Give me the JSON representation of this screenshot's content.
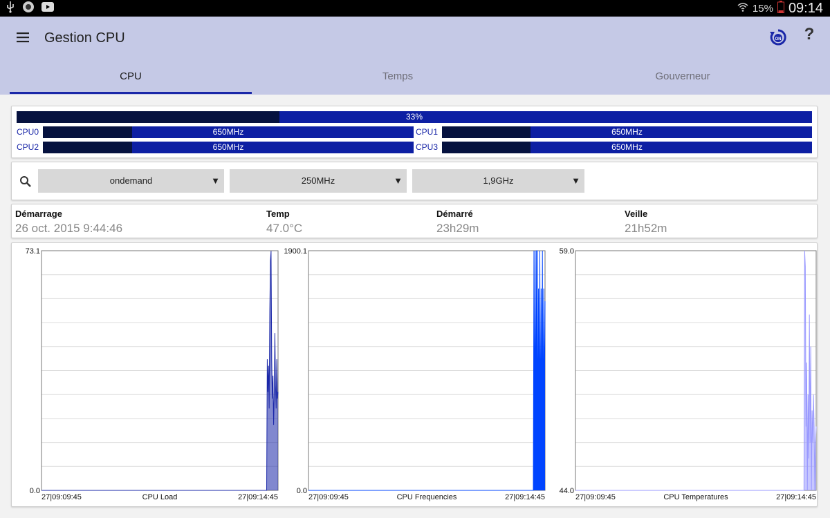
{
  "status_bar": {
    "left_icons": [
      "usb-icon",
      "camera-icon",
      "youtube-icon"
    ],
    "battery_percent": "15%",
    "time": "09:14"
  },
  "app": {
    "title": "Gestion CPU",
    "tabs": [
      {
        "label": "CPU",
        "active": true
      },
      {
        "label": "Temps",
        "active": false
      },
      {
        "label": "Gouverneur",
        "active": false
      }
    ]
  },
  "cpu_usage": {
    "total_label": "33%",
    "total_fraction": 0.33,
    "cores": [
      {
        "name": "CPU0",
        "freq": "650MHz",
        "fraction": 0.24
      },
      {
        "name": "CPU1",
        "freq": "650MHz",
        "fraction": 0.24
      },
      {
        "name": "CPU2",
        "freq": "650MHz",
        "fraction": 0.24
      },
      {
        "name": "CPU3",
        "freq": "650MHz",
        "fraction": 0.24
      }
    ]
  },
  "governor": {
    "governor": "ondemand",
    "min_freq": "250MHz",
    "max_freq": "1,9GHz"
  },
  "info": {
    "boot_label": "Démarrage",
    "boot_value": "26 oct. 2015 9:44:46",
    "temp_label": "Temp",
    "temp_value": "47.0°C",
    "uptime_label": "Démarré",
    "uptime_value": "23h29m",
    "sleep_label": "Veille",
    "sleep_value": "21h52m"
  },
  "colors": {
    "appbar": "#c5c9e6",
    "accent": "#1a27a8",
    "bar": "#0d1fa3",
    "bar_fill": "#06123f",
    "chart_load": "#1a27a8",
    "chart_freq": "#0044ff",
    "chart_temp": "#9999ff"
  },
  "chart_data": [
    {
      "type": "area",
      "title": "CPU Load",
      "x_start": "27|09:09:45",
      "x_end": "27|09:14:45",
      "ylim": [
        0.0,
        73.1
      ],
      "y_max_label": "73.1",
      "y_min_label": "0.0",
      "grid": true,
      "values": [
        0,
        0,
        0,
        0,
        0,
        0,
        0,
        0,
        0,
        0,
        0,
        0,
        0,
        0,
        0,
        0,
        0,
        0,
        0,
        0,
        0,
        0,
        0,
        0,
        0,
        0,
        0,
        0,
        0,
        0,
        0,
        0,
        0,
        0,
        0,
        0,
        0,
        0,
        0,
        0,
        0,
        0,
        0,
        0,
        0,
        0,
        0,
        0,
        0,
        0,
        0,
        0,
        0,
        0,
        0,
        0,
        0,
        0,
        0,
        0,
        0,
        0,
        0,
        0,
        0,
        0,
        0,
        0,
        0,
        0,
        0,
        0,
        0,
        0,
        0,
        0,
        0,
        0,
        0,
        0,
        0,
        0,
        0,
        0,
        0,
        0,
        0,
        0,
        0,
        0,
        0,
        0,
        0,
        0,
        0,
        0,
        0,
        0,
        0,
        0,
        0,
        0,
        0,
        0,
        0,
        0,
        0,
        0,
        0,
        0,
        0,
        0,
        0,
        0,
        0,
        0,
        0,
        0,
        0,
        0,
        0,
        0,
        0,
        0,
        0,
        0,
        0,
        0,
        0,
        0,
        0,
        0,
        0,
        0,
        0,
        0,
        0,
        0,
        0,
        0,
        0,
        0,
        0,
        0,
        0,
        0,
        0,
        0,
        0,
        0,
        0,
        0,
        0,
        0,
        0,
        0,
        0,
        0,
        0,
        0,
        0,
        0,
        0,
        0,
        0,
        0,
        0,
        0,
        0,
        0,
        0,
        0,
        0,
        0,
        0,
        0,
        0,
        0,
        0,
        0,
        0,
        0,
        0,
        0,
        0,
        0,
        0,
        0,
        0,
        0,
        0,
        0,
        0,
        0,
        0,
        0,
        0,
        0,
        0,
        0,
        0,
        0,
        0,
        0,
        0,
        0,
        0,
        0,
        0,
        0,
        0,
        0,
        0,
        0,
        0,
        0,
        0,
        0,
        0,
        0,
        0,
        0,
        0,
        0,
        0,
        0,
        0,
        0,
        0,
        0,
        0,
        0,
        0,
        0,
        0,
        0,
        0,
        0,
        0,
        0,
        0,
        0,
        0,
        0,
        0,
        0,
        0,
        0,
        0,
        0,
        0,
        0,
        0,
        0,
        0,
        0,
        0,
        0,
        0,
        0,
        0,
        0,
        0,
        0,
        0,
        0,
        0,
        0,
        0,
        0,
        0,
        0,
        0,
        0,
        0,
        0,
        0,
        0,
        0,
        0,
        0,
        0,
        0,
        0,
        0,
        0,
        0,
        0,
        0,
        0,
        0,
        0,
        0,
        0,
        0,
        0,
        0,
        0,
        0,
        0,
        0,
        0,
        0,
        0,
        0,
        0,
        0,
        0,
        0,
        0,
        0,
        0,
        0,
        0,
        0,
        0,
        0,
        0,
        0,
        0,
        0,
        0,
        0,
        0,
        0,
        0,
        0,
        0,
        0,
        0,
        0,
        0,
        0,
        0,
        0,
        0,
        0,
        0,
        0,
        0,
        0,
        0,
        0,
        0,
        0,
        0,
        0,
        0,
        0,
        0,
        0,
        0,
        0,
        0,
        0,
        0,
        40,
        30,
        38,
        25,
        55,
        70,
        73,
        40,
        28,
        35,
        20,
        30,
        48,
        32,
        25,
        40,
        28,
        30
      ]
    },
    {
      "type": "area",
      "title": "CPU Frequencies",
      "x_start": "27|09:09:45",
      "x_end": "27|09:14:45",
      "ylim": [
        0.0,
        1900.1
      ],
      "y_max_label": "1900.1",
      "y_min_label": "0.0",
      "grid": true,
      "values": [
        0,
        0,
        0,
        0,
        0,
        0,
        0,
        0,
        0,
        0,
        0,
        0,
        0,
        0,
        0,
        0,
        0,
        0,
        0,
        0,
        0,
        0,
        0,
        0,
        0,
        0,
        0,
        0,
        0,
        0,
        0,
        0,
        0,
        0,
        0,
        0,
        0,
        0,
        0,
        0,
        0,
        0,
        0,
        0,
        0,
        0,
        0,
        0,
        0,
        0,
        0,
        0,
        0,
        0,
        0,
        0,
        0,
        0,
        0,
        0,
        0,
        0,
        0,
        0,
        0,
        0,
        0,
        0,
        0,
        0,
        0,
        0,
        0,
        0,
        0,
        0,
        0,
        0,
        0,
        0,
        0,
        0,
        0,
        0,
        0,
        0,
        0,
        0,
        0,
        0,
        0,
        0,
        0,
        0,
        0,
        0,
        0,
        0,
        0,
        0,
        0,
        0,
        0,
        0,
        0,
        0,
        0,
        0,
        0,
        0,
        0,
        0,
        0,
        0,
        0,
        0,
        0,
        0,
        0,
        0,
        0,
        0,
        0,
        0,
        0,
        0,
        0,
        0,
        0,
        0,
        0,
        0,
        0,
        0,
        0,
        0,
        0,
        0,
        0,
        0,
        0,
        0,
        0,
        0,
        0,
        0,
        0,
        0,
        0,
        0,
        0,
        0,
        0,
        0,
        0,
        0,
        0,
        0,
        0,
        0,
        0,
        0,
        0,
        0,
        0,
        0,
        0,
        0,
        0,
        0,
        0,
        0,
        0,
        0,
        0,
        0,
        0,
        0,
        0,
        0,
        0,
        0,
        0,
        0,
        0,
        0,
        0,
        0,
        0,
        0,
        0,
        0,
        0,
        0,
        0,
        0,
        0,
        0,
        0,
        0,
        0,
        0,
        0,
        0,
        0,
        0,
        0,
        0,
        0,
        0,
        0,
        0,
        0,
        0,
        0,
        0,
        0,
        0,
        0,
        0,
        0,
        0,
        0,
        0,
        0,
        0,
        0,
        0,
        0,
        0,
        0,
        0,
        0,
        0,
        0,
        0,
        0,
        0,
        0,
        0,
        0,
        0,
        0,
        0,
        0,
        0,
        0,
        0,
        0,
        0,
        0,
        0,
        0,
        0,
        0,
        0,
        0,
        0,
        0,
        0,
        0,
        0,
        0,
        0,
        0,
        0,
        0,
        0,
        0,
        0,
        0,
        0,
        0,
        0,
        0,
        0,
        0,
        0,
        0,
        0,
        0,
        0,
        0,
        0,
        0,
        0,
        0,
        0,
        0,
        0,
        0,
        0,
        0,
        0,
        0,
        0,
        0,
        0,
        0,
        0,
        0,
        0,
        0,
        0,
        0,
        0,
        0,
        0,
        0,
        0,
        0,
        0,
        0,
        0,
        0,
        0,
        0,
        0,
        0,
        0,
        0,
        0,
        0,
        0,
        0,
        0,
        0,
        0,
        0,
        0,
        0,
        0,
        0,
        0,
        0,
        0,
        0,
        0,
        0,
        0,
        0,
        0,
        0,
        0,
        0,
        0,
        1900,
        250,
        1900,
        250,
        1900,
        1900,
        250,
        1600,
        250,
        1900,
        250,
        1600,
        250,
        1900,
        250,
        1600,
        650,
        1500
      ]
    },
    {
      "type": "area",
      "title": "CPU Temperatures",
      "x_start": "27|09:09:45",
      "x_end": "27|09:14:45",
      "ylim": [
        44.0,
        59.0
      ],
      "y_max_label": "59.0",
      "y_min_label": "44.0",
      "grid": true,
      "values": [
        44,
        44,
        44,
        44,
        44,
        44,
        44,
        44,
        44,
        44,
        44,
        44,
        44,
        44,
        44,
        44,
        44,
        44,
        44,
        44,
        44,
        44,
        44,
        44,
        44,
        44,
        44,
        44,
        44,
        44,
        44,
        44,
        44,
        44,
        44,
        44,
        44,
        44,
        44,
        44,
        44,
        44,
        44,
        44,
        44,
        44,
        44,
        44,
        44,
        44,
        44,
        44,
        44,
        44,
        44,
        44,
        44,
        44,
        44,
        44,
        44,
        44,
        44,
        44,
        44,
        44,
        44,
        44,
        44,
        44,
        44,
        44,
        44,
        44,
        44,
        44,
        44,
        44,
        44,
        44,
        44,
        44,
        44,
        44,
        44,
        44,
        44,
        44,
        44,
        44,
        44,
        44,
        44,
        44,
        44,
        44,
        44,
        44,
        44,
        44,
        44,
        44,
        44,
        44,
        44,
        44,
        44,
        44,
        44,
        44,
        44,
        44,
        44,
        44,
        44,
        44,
        44,
        44,
        44,
        44,
        44,
        44,
        44,
        44,
        44,
        44,
        44,
        44,
        44,
        44,
        44,
        44,
        44,
        44,
        44,
        44,
        44,
        44,
        44,
        44,
        44,
        44,
        44,
        44,
        44,
        44,
        44,
        44,
        44,
        44,
        44,
        44,
        44,
        44,
        44,
        44,
        44,
        44,
        44,
        44,
        44,
        44,
        44,
        44,
        44,
        44,
        44,
        44,
        44,
        44,
        44,
        44,
        44,
        44,
        44,
        44,
        44,
        44,
        44,
        44,
        44,
        44,
        44,
        44,
        44,
        44,
        44,
        44,
        44,
        44,
        44,
        44,
        44,
        44,
        44,
        44,
        44,
        44,
        44,
        44,
        44,
        44,
        44,
        44,
        44,
        44,
        44,
        44,
        44,
        44,
        44,
        44,
        44,
        44,
        44,
        44,
        44,
        44,
        44,
        44,
        44,
        44,
        44,
        44,
        44,
        44,
        44,
        44,
        44,
        44,
        44,
        44,
        44,
        44,
        44,
        44,
        44,
        44,
        44,
        44,
        44,
        44,
        44,
        44,
        44,
        44,
        44,
        44,
        44,
        44,
        44,
        44,
        44,
        44,
        44,
        44,
        44,
        44,
        44,
        44,
        44,
        44,
        44,
        44,
        44,
        44,
        44,
        44,
        44,
        44,
        44,
        44,
        44,
        44,
        44,
        44,
        44,
        44,
        44,
        44,
        44,
        44,
        44,
        44,
        44,
        44,
        44,
        44,
        44,
        44,
        44,
        44,
        44,
        44,
        44,
        44,
        44,
        44,
        44,
        44,
        44,
        44,
        44,
        44,
        44,
        44,
        44,
        44,
        44,
        44,
        44,
        44,
        44,
        44,
        44,
        44,
        44,
        44,
        44,
        44,
        44,
        44,
        44,
        44,
        44,
        44,
        44,
        44,
        44,
        44,
        44,
        44,
        44,
        44,
        44,
        44,
        44,
        44,
        59,
        58,
        48,
        52,
        44,
        50,
        46,
        55,
        47,
        53,
        44,
        49,
        47,
        50,
        48,
        44,
        47,
        48
      ]
    }
  ]
}
